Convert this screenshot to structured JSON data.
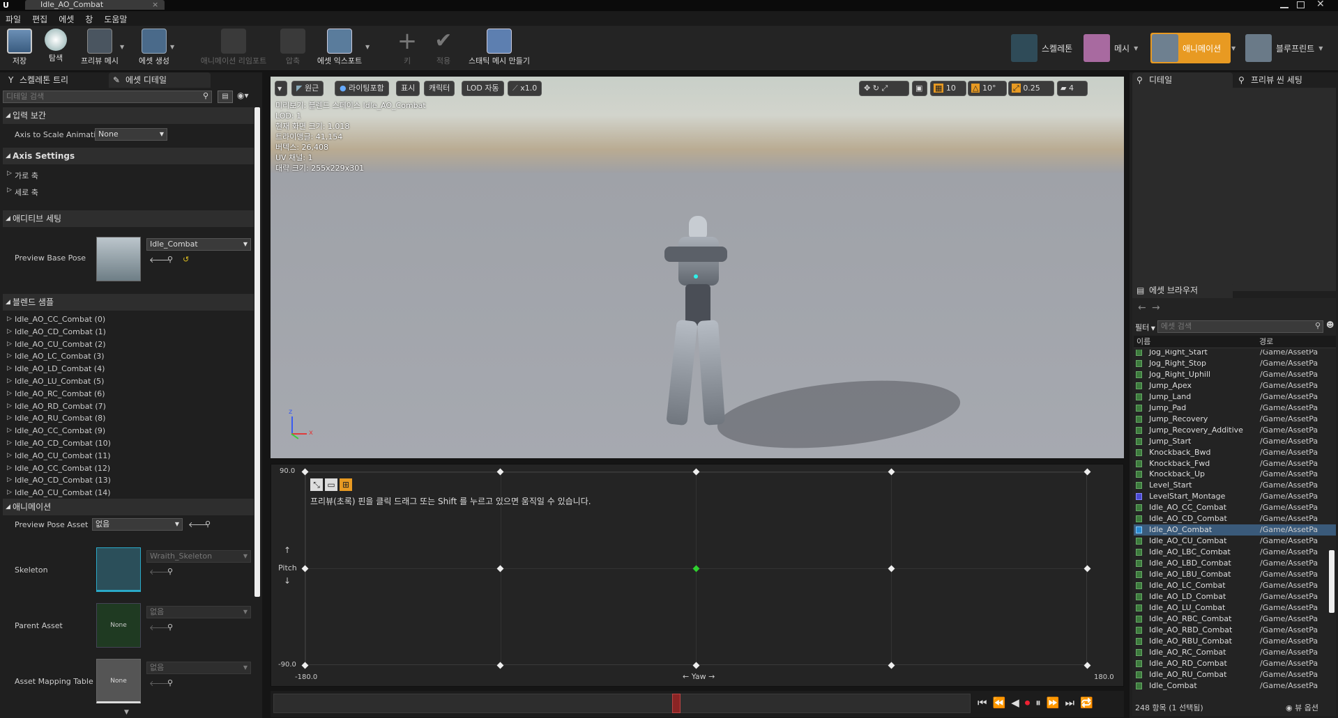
{
  "window": {
    "tab_title": "Idle_AO_Combat"
  },
  "menu": [
    "파일",
    "편집",
    "에셋",
    "창",
    "도움말"
  ],
  "toolbar": {
    "buttons": [
      {
        "label": "저장",
        "enabled": true
      },
      {
        "label": "탐색",
        "enabled": true
      },
      {
        "label": "프리뷰 메시",
        "enabled": true
      },
      {
        "label": "에셋 생성",
        "enabled": true
      },
      {
        "label": "애니메이션 리임포트",
        "enabled": false
      },
      {
        "label": "압축",
        "enabled": false
      },
      {
        "label": "에셋 익스포트",
        "enabled": true
      },
      {
        "label": "키",
        "enabled": false
      },
      {
        "label": "적용",
        "enabled": false
      },
      {
        "label": "스태틱 메시 만들기",
        "enabled": true
      }
    ],
    "modes": [
      {
        "label": "스켈레톤",
        "active": false
      },
      {
        "label": "메시",
        "active": false
      },
      {
        "label": "애니메이션",
        "active": true
      },
      {
        "label": "블루프린트",
        "active": false
      }
    ]
  },
  "left_panel": {
    "tabs": [
      "스켈레톤 트리",
      "에셋 디테일"
    ],
    "search_placeholder": "디테일 검색",
    "section_input": "입력 보간",
    "axis_to_scale_label": "Axis to Scale Animati",
    "axis_to_scale_value": "None",
    "section_axis": "Axis Settings",
    "axis_items": [
      "가로 축",
      "세로 축"
    ],
    "section_additive": "애디티브 세팅",
    "preview_base_pose_label": "Preview Base Pose",
    "preview_base_pose_value": "Idle_Combat",
    "section_samples": "블렌드 샘플",
    "samples": [
      "Idle_AO_CC_Combat (0)",
      "Idle_AO_CD_Combat (1)",
      "Idle_AO_CU_Combat (2)",
      "Idle_AO_LC_Combat (3)",
      "Idle_AO_LD_Combat (4)",
      "Idle_AO_LU_Combat (5)",
      "Idle_AO_RC_Combat (6)",
      "Idle_AO_RD_Combat (7)",
      "Idle_AO_RU_Combat (8)",
      "Idle_AO_CC_Combat (9)",
      "Idle_AO_CD_Combat (10)",
      "Idle_AO_CU_Combat (11)",
      "Idle_AO_CC_Combat (12)",
      "Idle_AO_CD_Combat (13)",
      "Idle_AO_CU_Combat (14)"
    ],
    "section_animation": "애니메이션",
    "preview_pose_asset_label": "Preview Pose Asset",
    "preview_pose_asset_value": "없음",
    "skeleton_label": "Skeleton",
    "skeleton_value": "Wraith_Skeleton",
    "parent_asset_label": "Parent Asset",
    "parent_asset_value": "없음",
    "parent_thumb": "None",
    "mapping_label": "Asset Mapping Table",
    "mapping_value": "없음",
    "mapping_thumb": "None"
  },
  "viewport": {
    "buttons": [
      "원근",
      "라이팅포함",
      "표시",
      "캐릭터",
      "LOD 자동",
      "x1.0"
    ],
    "snap": {
      "grid": "10",
      "rot": "10°",
      "scale": "0.25",
      "speed": "4"
    },
    "info": [
      "미리보기: 블렌드 스페이스 Idle_AO_Combat",
      "LOD: 1",
      "현재 화면 크기: 1.018",
      "트라이앵글: 41,154",
      "버텍스: 26,408",
      "UV 채널: 1",
      "대략 크기: 255x229x301"
    ],
    "axis_x": "x",
    "axis_z": "z"
  },
  "blendspace": {
    "hint": "프리뷰(초록) 핀을 클릭 드래그 또는 Shift 를 누르고 있으면 움직일 수 있습니다.",
    "y_max": "90.0",
    "y_min": "-90.0",
    "y_label": "Pitch",
    "x_min": "-180.0",
    "x_max": "180.0",
    "x_label": "Yaw",
    "x_range": [
      -180,
      180
    ],
    "y_range": [
      -90,
      90
    ],
    "points": [
      [
        -180,
        90
      ],
      [
        -90,
        90
      ],
      [
        0,
        90
      ],
      [
        90,
        90
      ],
      [
        180,
        90
      ],
      [
        -180,
        0
      ],
      [
        -90,
        0
      ],
      [
        90,
        0
      ],
      [
        180,
        0
      ],
      [
        -180,
        -90
      ],
      [
        -90,
        -90
      ],
      [
        0,
        -90
      ],
      [
        90,
        -90
      ],
      [
        180,
        -90
      ]
    ],
    "preview_point": [
      0,
      0
    ]
  },
  "right_panel": {
    "tabs": [
      "디테일",
      "프리뷰 씬 세팅"
    ],
    "browser_tab": "에셋 브라우저",
    "filter_label": "필터",
    "search_placeholder": "에셋 검색",
    "col_name": "이름",
    "col_path": "경로",
    "assets": [
      {
        "name": "Jog_Right_Start",
        "path": "/Game/AssetPa",
        "sel": false
      },
      {
        "name": "Jog_Right_Stop",
        "path": "/Game/AssetPa",
        "sel": false
      },
      {
        "name": "Jog_Right_Uphill",
        "path": "/Game/AssetPa",
        "sel": false
      },
      {
        "name": "Jump_Apex",
        "path": "/Game/AssetPa",
        "sel": false
      },
      {
        "name": "Jump_Land",
        "path": "/Game/AssetPa",
        "sel": false
      },
      {
        "name": "Jump_Pad",
        "path": "/Game/AssetPa",
        "sel": false
      },
      {
        "name": "Jump_Recovery",
        "path": "/Game/AssetPa",
        "sel": false
      },
      {
        "name": "Jump_Recovery_Additive",
        "path": "/Game/AssetPa",
        "sel": false
      },
      {
        "name": "Jump_Start",
        "path": "/Game/AssetPa",
        "sel": false
      },
      {
        "name": "Knockback_Bwd",
        "path": "/Game/AssetPa",
        "sel": false
      },
      {
        "name": "Knockback_Fwd",
        "path": "/Game/AssetPa",
        "sel": false
      },
      {
        "name": "Knockback_Up",
        "path": "/Game/AssetPa",
        "sel": false
      },
      {
        "name": "Level_Start",
        "path": "/Game/AssetPa",
        "sel": false
      },
      {
        "name": "LevelStart_Montage",
        "path": "/Game/AssetPa",
        "sel": false
      },
      {
        "name": "Idle_AO_CC_Combat",
        "path": "/Game/AssetPa",
        "sel": false
      },
      {
        "name": "Idle_AO_CD_Combat",
        "path": "/Game/AssetPa",
        "sel": false
      },
      {
        "name": "Idle_AO_Combat",
        "path": "/Game/AssetPa",
        "sel": true
      },
      {
        "name": "Idle_AO_CU_Combat",
        "path": "/Game/AssetPa",
        "sel": false
      },
      {
        "name": "Idle_AO_LBC_Combat",
        "path": "/Game/AssetPa",
        "sel": false
      },
      {
        "name": "Idle_AO_LBD_Combat",
        "path": "/Game/AssetPa",
        "sel": false
      },
      {
        "name": "Idle_AO_LBU_Combat",
        "path": "/Game/AssetPa",
        "sel": false
      },
      {
        "name": "Idle_AO_LC_Combat",
        "path": "/Game/AssetPa",
        "sel": false
      },
      {
        "name": "Idle_AO_LD_Combat",
        "path": "/Game/AssetPa",
        "sel": false
      },
      {
        "name": "Idle_AO_LU_Combat",
        "path": "/Game/AssetPa",
        "sel": false
      },
      {
        "name": "Idle_AO_RBC_Combat",
        "path": "/Game/AssetPa",
        "sel": false
      },
      {
        "name": "Idle_AO_RBD_Combat",
        "path": "/Game/AssetPa",
        "sel": false
      },
      {
        "name": "Idle_AO_RBU_Combat",
        "path": "/Game/AssetPa",
        "sel": false
      },
      {
        "name": "Idle_AO_RC_Combat",
        "path": "/Game/AssetPa",
        "sel": false
      },
      {
        "name": "Idle_AO_RD_Combat",
        "path": "/Game/AssetPa",
        "sel": false
      },
      {
        "name": "Idle_AO_RU_Combat",
        "path": "/Game/AssetPa",
        "sel": false
      },
      {
        "name": "Idle_Combat",
        "path": "/Game/AssetPa",
        "sel": false
      }
    ],
    "status": "248 항목 (1 선택됨)",
    "view_options": "뷰 옵션"
  },
  "colors": {
    "accent": "#e89a22",
    "preview_pin": "#2fd12f",
    "selected_row": "#3a5a7a"
  }
}
